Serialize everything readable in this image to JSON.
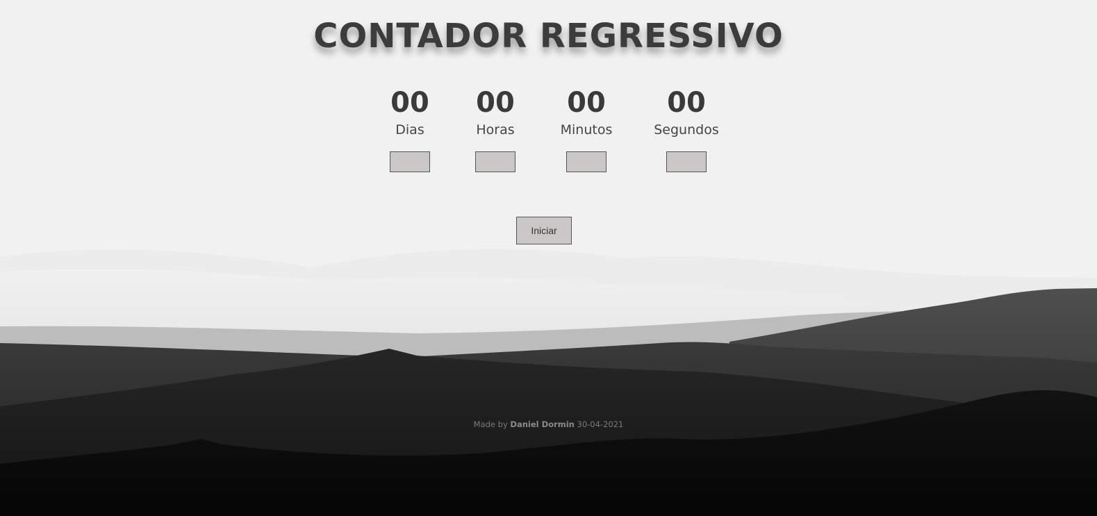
{
  "page": {
    "title": "CONTADOR REGRESSIVO"
  },
  "countdown": {
    "days": {
      "value": "00",
      "label": "Dias",
      "input_value": ""
    },
    "hours": {
      "value": "00",
      "label": "Horas",
      "input_value": ""
    },
    "minutes": {
      "value": "00",
      "label": "Minutos",
      "input_value": ""
    },
    "seconds": {
      "value": "00",
      "label": "Segundos",
      "input_value": ""
    }
  },
  "controls": {
    "start_label": "Iniciar"
  },
  "footer": {
    "prefix": "Made by",
    "author": "Daniel Dormin",
    "date": "30-04-2021"
  },
  "colors": {
    "background": "#f1f1f1",
    "text": "#3c3c3c",
    "button_bg": "#cbc7c7",
    "mountain_far": "#4a4a4a",
    "mountain_near": "#080808"
  }
}
